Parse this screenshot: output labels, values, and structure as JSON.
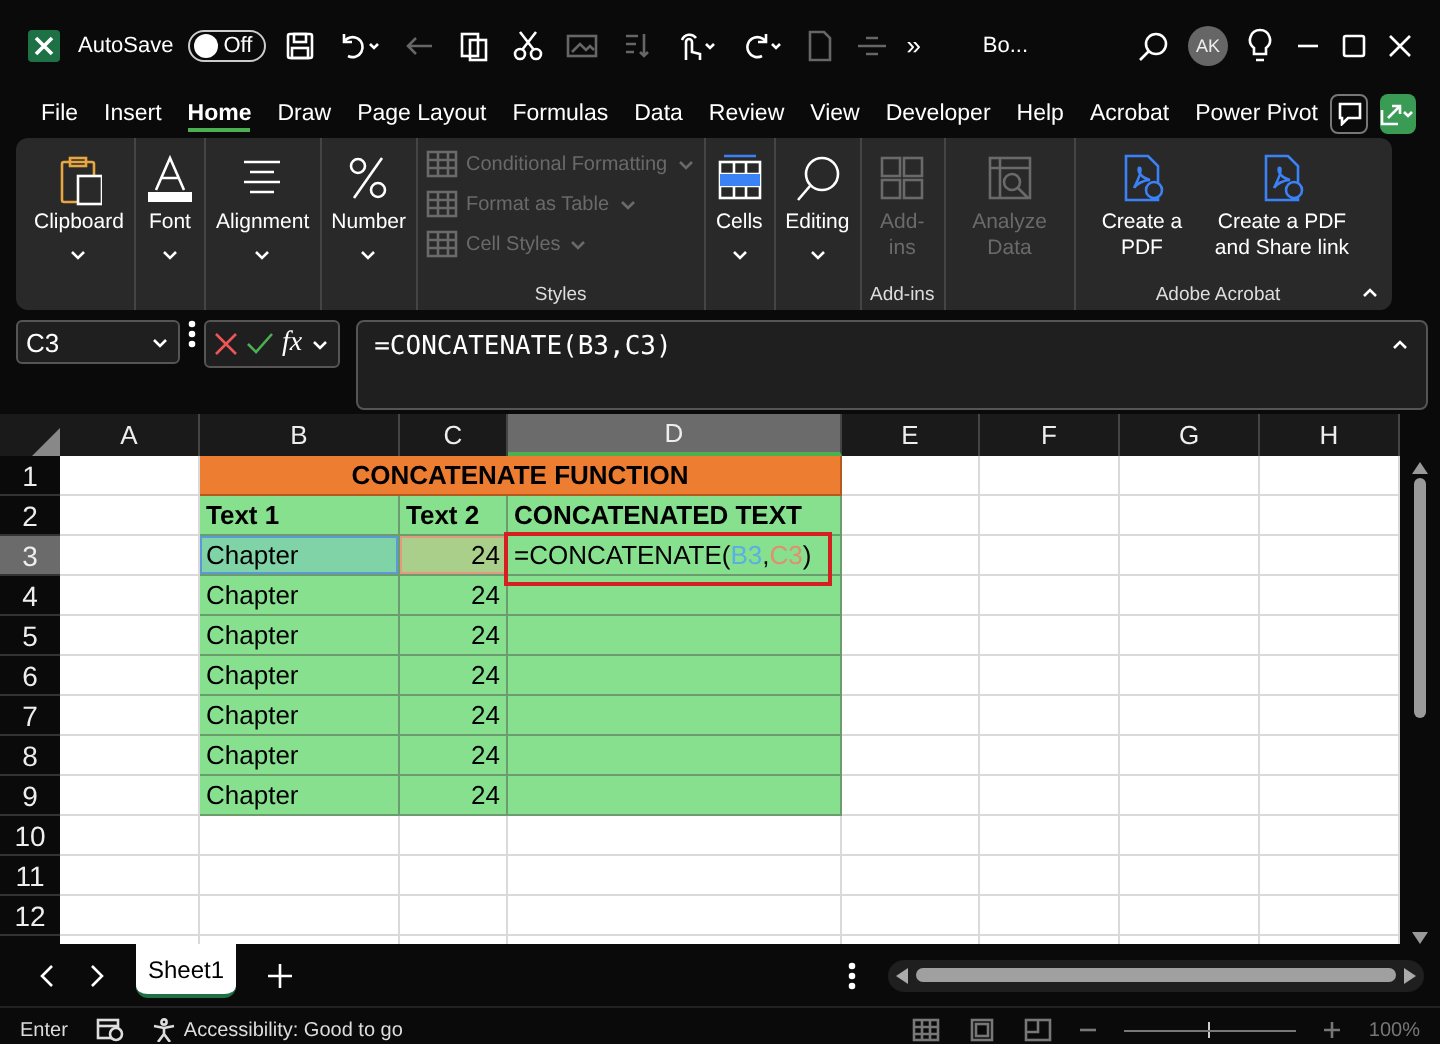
{
  "title_bar": {
    "autosave_label": "AutoSave",
    "autosave": {
      "label": "Off",
      "on": false
    },
    "overflow": "»",
    "title": "Bo...",
    "avatar": "AK"
  },
  "menu": {
    "tabs": [
      {
        "label": "File",
        "selected": false
      },
      {
        "label": "Insert",
        "selected": false
      },
      {
        "label": "Home",
        "selected": true
      },
      {
        "label": "Draw",
        "selected": false
      },
      {
        "label": "Page Layout",
        "selected": false
      },
      {
        "label": "Formulas",
        "selected": false
      },
      {
        "label": "Data",
        "selected": false
      },
      {
        "label": "Review",
        "selected": false
      },
      {
        "label": "View",
        "selected": false
      },
      {
        "label": "Developer",
        "selected": false
      },
      {
        "label": "Help",
        "selected": false
      },
      {
        "label": "Acrobat",
        "selected": false
      },
      {
        "label": "Power Pivot",
        "selected": false
      }
    ]
  },
  "ribbon": {
    "groups": [
      {
        "kind": "large",
        "buttons": [
          {
            "label": "Clipboard",
            "kind": "clipboard",
            "disabled": false,
            "dropdown": true
          }
        ]
      },
      {
        "kind": "large",
        "buttons": [
          {
            "label": "Font",
            "kind": "font",
            "disabled": false,
            "dropdown": true
          }
        ]
      },
      {
        "kind": "large",
        "buttons": [
          {
            "label": "Alignment",
            "kind": "alignment",
            "disabled": false,
            "dropdown": true
          }
        ]
      },
      {
        "kind": "large",
        "buttons": [
          {
            "label": "Number",
            "kind": "number",
            "disabled": false,
            "dropdown": true
          }
        ]
      },
      {
        "kind": "small",
        "label": "Styles",
        "buttons": [
          {
            "label": "Conditional Formatting",
            "kind": "grid",
            "disabled": true,
            "dropdown": true
          },
          {
            "label": "Format as Table",
            "kind": "grid",
            "disabled": true,
            "dropdown": true
          },
          {
            "label": "Cell Styles",
            "kind": "grid",
            "disabled": true,
            "dropdown": true
          }
        ]
      },
      {
        "kind": "large",
        "buttons": [
          {
            "label": "Cells",
            "kind": "cells",
            "disabled": false,
            "dropdown": true
          }
        ]
      },
      {
        "kind": "large",
        "buttons": [
          {
            "label": "Editing",
            "kind": "search",
            "disabled": false,
            "dropdown": true
          }
        ]
      },
      {
        "kind": "large",
        "label": "Add-ins",
        "buttons": [
          {
            "label": "Add-ins",
            "kind": "addins",
            "disabled": true,
            "dropdown": false
          }
        ]
      },
      {
        "kind": "large",
        "buttons": [
          {
            "label": "Analyze Data",
            "kind": "analyze",
            "disabled": true,
            "dropdown": false
          }
        ]
      },
      {
        "kind": "large",
        "label": "Adobe Acrobat",
        "buttons": [
          {
            "label": "Create a PDF",
            "kind": "pdf",
            "disabled": false,
            "dropdown": false
          },
          {
            "label": "Create a PDF and Share link",
            "kind": "pdf",
            "disabled": false,
            "dropdown": false
          }
        ]
      }
    ]
  },
  "formula_bar": {
    "name_box": "C3",
    "fx": "fx",
    "formula": "=CONCATENATE(B3,C3)"
  },
  "sheet": {
    "columns": [
      {
        "label": "A",
        "selected": false
      },
      {
        "label": "B",
        "selected": false
      },
      {
        "label": "C",
        "selected": false
      },
      {
        "label": "D",
        "selected": true
      },
      {
        "label": "E",
        "selected": false
      },
      {
        "label": "F",
        "selected": false
      },
      {
        "label": "G",
        "selected": false
      },
      {
        "label": "H",
        "selected": false
      }
    ],
    "row_numbers": [
      {
        "label": "1",
        "selected": false
      },
      {
        "label": "2",
        "selected": false
      },
      {
        "label": "3",
        "selected": true
      },
      {
        "label": "4",
        "selected": false
      },
      {
        "label": "5",
        "selected": false
      },
      {
        "label": "6",
        "selected": false
      },
      {
        "label": "7",
        "selected": false
      },
      {
        "label": "8",
        "selected": false
      },
      {
        "label": "9",
        "selected": false
      },
      {
        "label": "10",
        "selected": false
      },
      {
        "label": "11",
        "selected": false
      },
      {
        "label": "12",
        "selected": false
      }
    ],
    "table": {
      "title": "CONCATENATE FUNCTION",
      "headers": [
        "Text 1",
        "Text 2",
        "CONCATENATED TEXT"
      ],
      "rows": [
        {
          "text_1": "Chapter",
          "text_1_referenced": true,
          "text_2": "24",
          "text_2_referenced": true,
          "outlined": true,
          "formula": {
            "opening": "=CONCATENATE(",
            "arguments": [
              {
                "text": "B3",
                "color": "#5ab0e0"
              },
              {
                "text": "C3",
                "color": "#e0906f"
              }
            ],
            "separator": ",",
            "closing": ")"
          }
        },
        {
          "text_1": "Chapter",
          "text_1_referenced": false,
          "text_2": "24",
          "text_2_referenced": false,
          "outlined": false
        },
        {
          "text_1": "Chapter",
          "text_1_referenced": false,
          "text_2": "24",
          "text_2_referenced": false,
          "outlined": false
        },
        {
          "text_1": "Chapter",
          "text_1_referenced": false,
          "text_2": "24",
          "text_2_referenced": false,
          "outlined": false
        },
        {
          "text_1": "Chapter",
          "text_1_referenced": false,
          "text_2": "24",
          "text_2_referenced": false,
          "outlined": false
        },
        {
          "text_1": "Chapter",
          "text_1_referenced": false,
          "text_2": "24",
          "text_2_referenced": false,
          "outlined": false
        },
        {
          "text_1": "Chapter",
          "text_1_referenced": false,
          "text_2": "24",
          "text_2_referenced": false,
          "outlined": false
        }
      ]
    }
  },
  "sheet_tabs": [
    {
      "label": "Sheet1",
      "selected": true
    }
  ],
  "status_bar": {
    "mode": "Enter",
    "accessibility": "Accessibility: Good to go",
    "zoom": {
      "level": 0.5,
      "reading": "100%"
    }
  }
}
